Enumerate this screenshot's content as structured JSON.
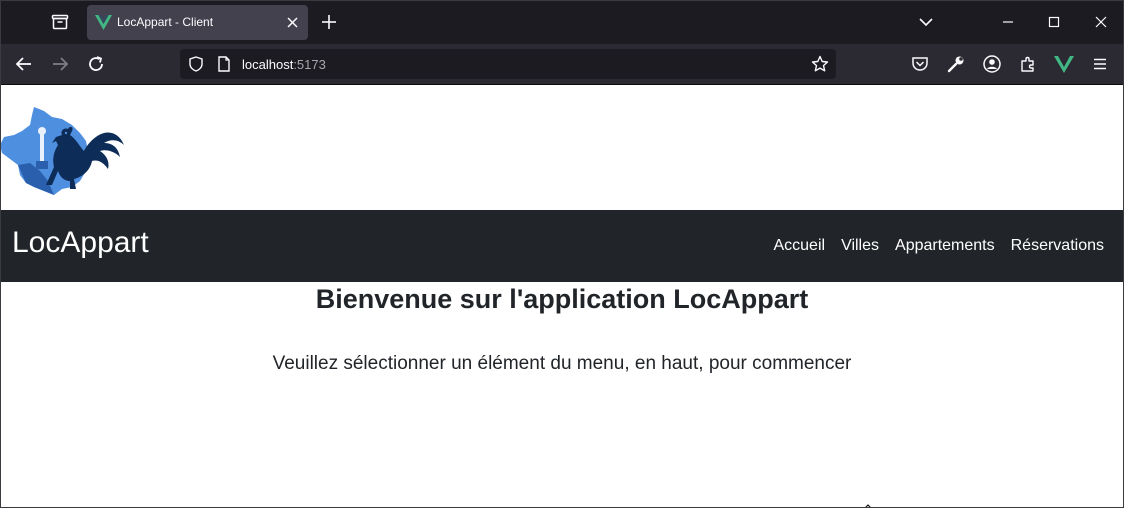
{
  "browser": {
    "tab": {
      "title": "LocAppart - Client",
      "favicon": "vue-logo-icon"
    },
    "url": {
      "host": "localhost",
      "port": ":5173"
    },
    "icons": {
      "tab_list": "tab-list-icon",
      "new_tab": "plus-icon",
      "tab_overflow": "chevron-down-icon",
      "minimize": "minimize-icon",
      "maximize": "maximize-icon",
      "close": "close-icon",
      "back": "back-arrow-icon",
      "forward": "forward-arrow-icon",
      "reload": "reload-icon",
      "shield": "shield-icon",
      "page": "page-icon",
      "bookmark": "star-icon",
      "pocket": "pocket-icon",
      "devtools": "wrench-icon",
      "account": "account-icon",
      "extensions": "puzzle-icon",
      "vue_devtools": "vue-devtools-icon",
      "menu": "hamburger-menu-icon"
    }
  },
  "app": {
    "brand": "LocAppart",
    "menu": [
      {
        "label": "Accueil"
      },
      {
        "label": "Villes"
      },
      {
        "label": "Appartements"
      },
      {
        "label": "Réservations"
      }
    ],
    "welcome": "Bienvenue sur l'application LocAppart",
    "instructions": "Veuillez sélectionner un élément du menu, en haut, pour commencer",
    "logo": "france-rooster-logo"
  },
  "colors": {
    "chrome_dark": "#1c1b22",
    "toolbar": "#2b2a33",
    "tab_active": "#42414d",
    "navbar": "#212529",
    "vue_green": "#41b883",
    "logo_light_blue": "#4f8fe0",
    "logo_dark_blue": "#0d2c57"
  }
}
